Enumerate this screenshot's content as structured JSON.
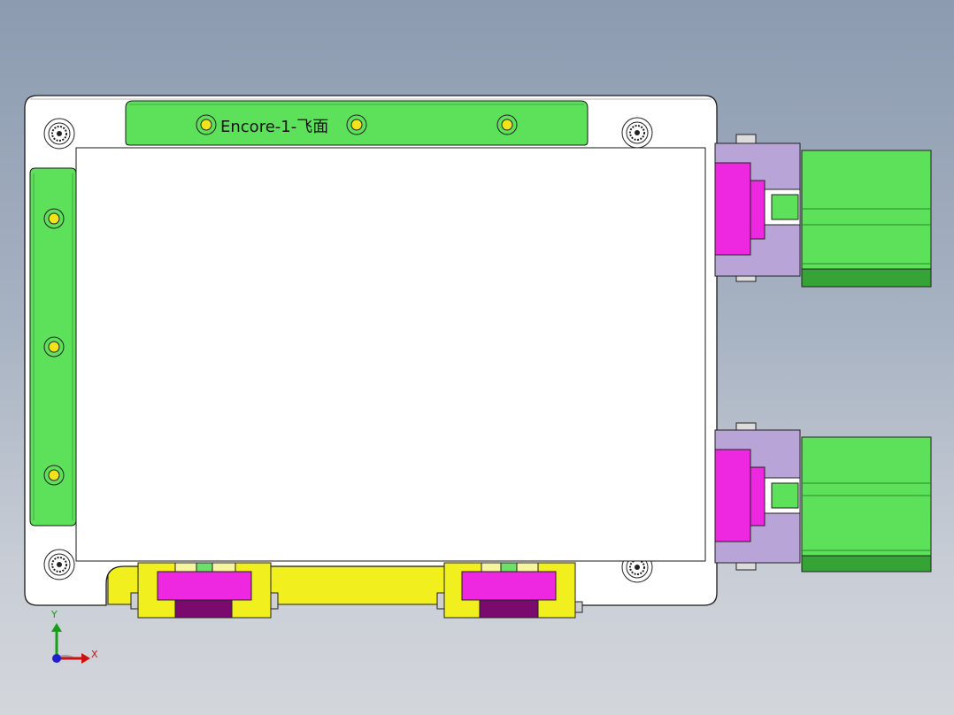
{
  "part_label": "Encore-1-飞面",
  "triad": {
    "x_label": "X",
    "y_label": "Y"
  },
  "colors": {
    "background_top": "#8c9bb0",
    "base_plate": "#ffffff",
    "green_part": "#5de05a",
    "magenta_part": "#ee28e0",
    "lavender_part": "#b9a4d8",
    "yellow_part": "#f2ef1f",
    "screw_dot": "#f4e21a"
  }
}
